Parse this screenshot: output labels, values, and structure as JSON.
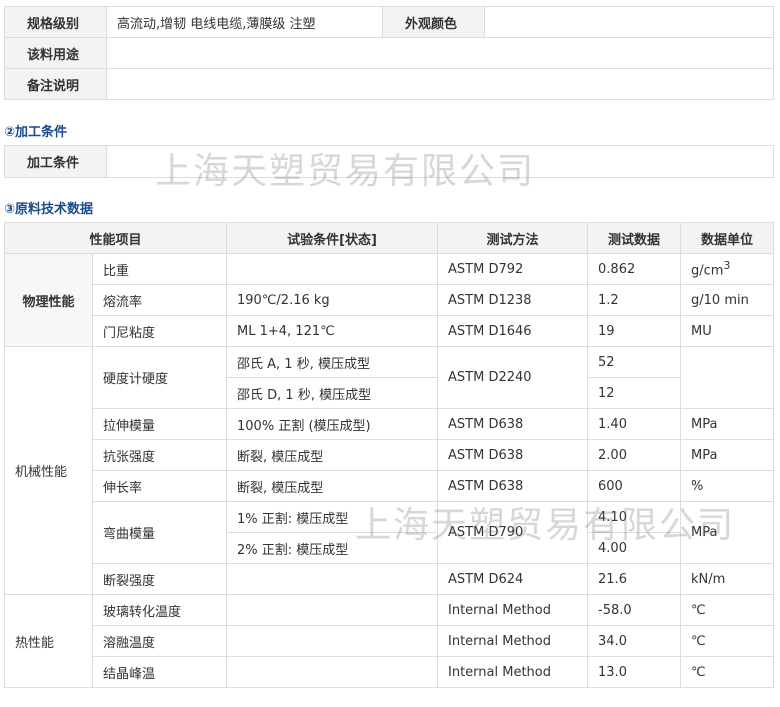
{
  "info": {
    "grade_label": "规格级别",
    "grade_value": "高流动,增韧 电线电缆,薄膜级 注塑",
    "color_label": "外观颜色",
    "color_value": "",
    "usage_label": "该料用途",
    "usage_value": "",
    "notes_label": "备注说明",
    "notes_value": ""
  },
  "section2_title": "②加工条件",
  "processing": {
    "label": "加工条件",
    "value": ""
  },
  "section3_title": "③原料技术数据",
  "tech": {
    "headers": [
      "性能项目",
      "试验条件[状态]",
      "测试方法",
      "测试数据",
      "数据单位"
    ],
    "categories": {
      "physical": "物理性能",
      "mechanical": "机械性能",
      "thermal": "热性能"
    },
    "rows": [
      {
        "item": "比重",
        "condition": "",
        "method": "ASTM D792",
        "value": "0.862",
        "unit_base": "g/cm",
        "unit_sup": "3"
      },
      {
        "item": "熔流率",
        "condition": "190℃/2.16 kg",
        "method": "ASTM D1238",
        "value": "1.2",
        "unit": "g/10 min"
      },
      {
        "item": "门尼粘度",
        "condition": "ML 1+4, 121℃",
        "method": "ASTM D1646",
        "value": "19",
        "unit": "MU"
      },
      {
        "item": "硬度计硬度",
        "condition": "邵氏 A, 1 秒, 模压成型",
        "method": "ASTM D2240",
        "value": "52",
        "unit": ""
      },
      {
        "condition": "邵氏 D, 1 秒, 模压成型",
        "value": "12"
      },
      {
        "item": "拉伸模量",
        "condition": "100% 正割 (模压成型)",
        "method": "ASTM D638",
        "value": "1.40",
        "unit": "MPa"
      },
      {
        "item": "抗张强度",
        "condition": "断裂, 模压成型",
        "method": "ASTM D638",
        "value": "2.00",
        "unit": "MPa"
      },
      {
        "item": "伸长率",
        "condition": "断裂, 模压成型",
        "method": "ASTM D638",
        "value": "600",
        "unit": "%"
      },
      {
        "item": "弯曲模量",
        "condition": "1% 正割: 模压成型",
        "method": "ASTM D790",
        "value": "4.10",
        "unit": "MPa"
      },
      {
        "condition": "2% 正割: 模压成型",
        "value": "4.00"
      },
      {
        "item": "断裂强度",
        "condition": "",
        "method": "ASTM D624",
        "value": "21.6",
        "unit": "kN/m"
      },
      {
        "item": "玻璃转化温度",
        "condition": "",
        "method": "Internal Method",
        "value": "-58.0",
        "unit": "℃"
      },
      {
        "item": "溶融温度",
        "condition": "",
        "method": "Internal Method",
        "value": "34.0",
        "unit": "℃"
      },
      {
        "item": "结晶峰温",
        "condition": "",
        "method": "Internal Method",
        "value": "13.0",
        "unit": "℃"
      }
    ]
  },
  "watermark": "上海天塑贸易有限公司"
}
